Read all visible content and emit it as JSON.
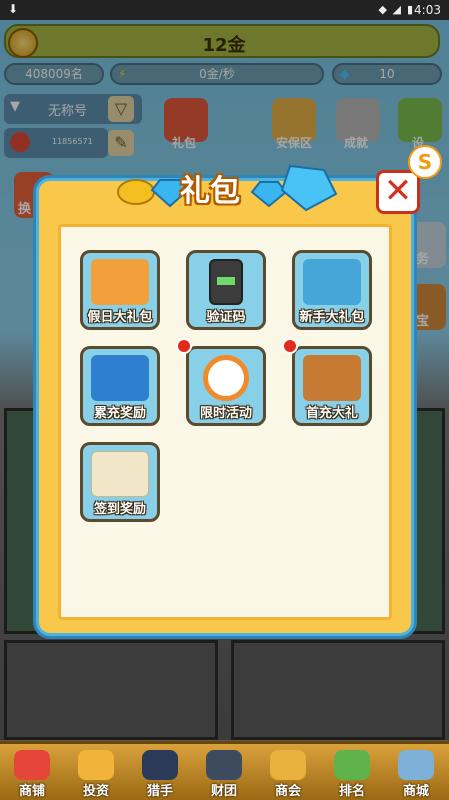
{
  "status": {
    "time": "4:03"
  },
  "header": {
    "gold": "12金",
    "rank": "408009名",
    "rate": "0金/秒",
    "gems": "10"
  },
  "player": {
    "name": "无称号",
    "id": "11856571"
  },
  "top_menu": [
    {
      "label": "礼包"
    },
    {
      "label": "安保区"
    },
    {
      "label": "成就"
    },
    {
      "label": "设"
    }
  ],
  "side_labels": {
    "left": "换",
    "right_task": "务",
    "right_treasure": "宝"
  },
  "modal": {
    "title": "礼包",
    "close_label": "✕",
    "badge": "S",
    "items": [
      {
        "label": "假日大礼包",
        "has_alert": false,
        "color": "#f2a03b"
      },
      {
        "label": "验证码",
        "has_alert": false,
        "color": "#3c3c3c"
      },
      {
        "label": "新手大礼包",
        "has_alert": false,
        "color": "#46a6d8"
      },
      {
        "label": "累充奖励",
        "has_alert": false,
        "color": "#2f7fd1"
      },
      {
        "label": "限时活动",
        "has_alert": true,
        "color": "#f08a2a"
      },
      {
        "label": "首充大礼",
        "has_alert": true,
        "color": "#c77a33"
      },
      {
        "label": "签到奖励",
        "has_alert": false,
        "color": "#f1e7c8"
      }
    ]
  },
  "bottom_nav": [
    {
      "label": "商铺"
    },
    {
      "label": "投资"
    },
    {
      "label": "猎手"
    },
    {
      "label": "财团"
    },
    {
      "label": "商会"
    },
    {
      "label": "排名"
    },
    {
      "label": "商城"
    }
  ]
}
